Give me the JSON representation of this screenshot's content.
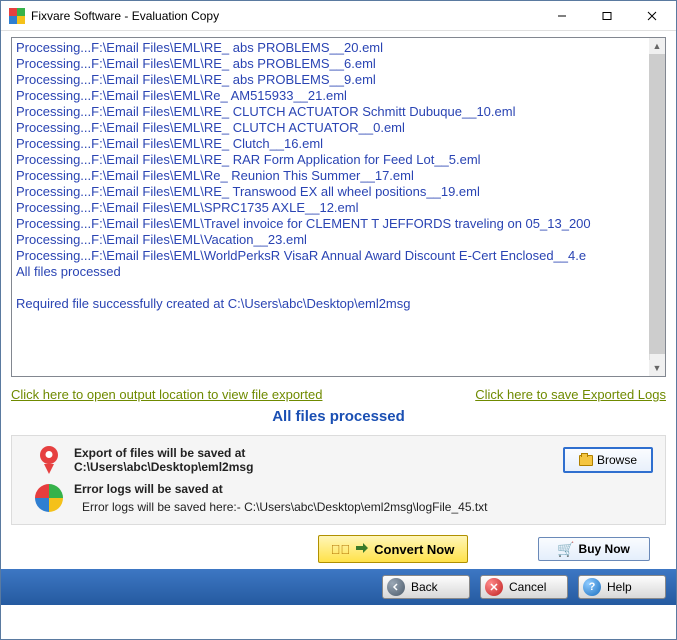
{
  "window": {
    "title": "Fixvare Software - Evaluation Copy"
  },
  "log_lines": [
    "Processing...F:\\Email Files\\EML\\RE_ abs PROBLEMS__20.eml",
    "Processing...F:\\Email Files\\EML\\RE_ abs PROBLEMS__6.eml",
    "Processing...F:\\Email Files\\EML\\RE_ abs PROBLEMS__9.eml",
    "Processing...F:\\Email Files\\EML\\Re_ AM515933__21.eml",
    "Processing...F:\\Email Files\\EML\\RE_ CLUTCH ACTUATOR Schmitt Dubuque__10.eml",
    "Processing...F:\\Email Files\\EML\\RE_ CLUTCH ACTUATOR__0.eml",
    "Processing...F:\\Email Files\\EML\\RE_ Clutch__16.eml",
    "Processing...F:\\Email Files\\EML\\RE_ RAR Form Application for Feed Lot__5.eml",
    "Processing...F:\\Email Files\\EML\\Re_ Reunion This Summer__17.eml",
    "Processing...F:\\Email Files\\EML\\RE_ Transwood EX all wheel positions__19.eml",
    "Processing...F:\\Email Files\\EML\\SPRC1735 AXLE__12.eml",
    "Processing...F:\\Email Files\\EML\\Travel invoice for CLEMENT T JEFFORDS traveling on 05_13_200",
    "Processing...F:\\Email Files\\EML\\Vacation__23.eml",
    "Processing...F:\\Email Files\\EML\\WorldPerksR VisaR Annual Award Discount E-Cert Enclosed__4.e",
    "All files processed",
    "",
    "Required file successfully created at C:\\Users\\abc\\Desktop\\eml2msg"
  ],
  "links": {
    "open_output": "Click here to open output location to view file exported",
    "save_logs": "Click here to save Exported Logs"
  },
  "status": "All files processed",
  "export_section": {
    "heading": "Export of files will be saved at",
    "path": "C:\\Users\\abc\\Desktop\\eml2msg",
    "browse_label": "Browse"
  },
  "error_section": {
    "heading": "Error logs will be saved at",
    "detail": "Error logs will be saved here:- C:\\Users\\abc\\Desktop\\eml2msg\\logFile_45.txt"
  },
  "actions": {
    "convert": "Convert Now",
    "buy": "Buy Now"
  },
  "footer": {
    "back": "Back",
    "cancel": "Cancel",
    "help": "Help"
  }
}
